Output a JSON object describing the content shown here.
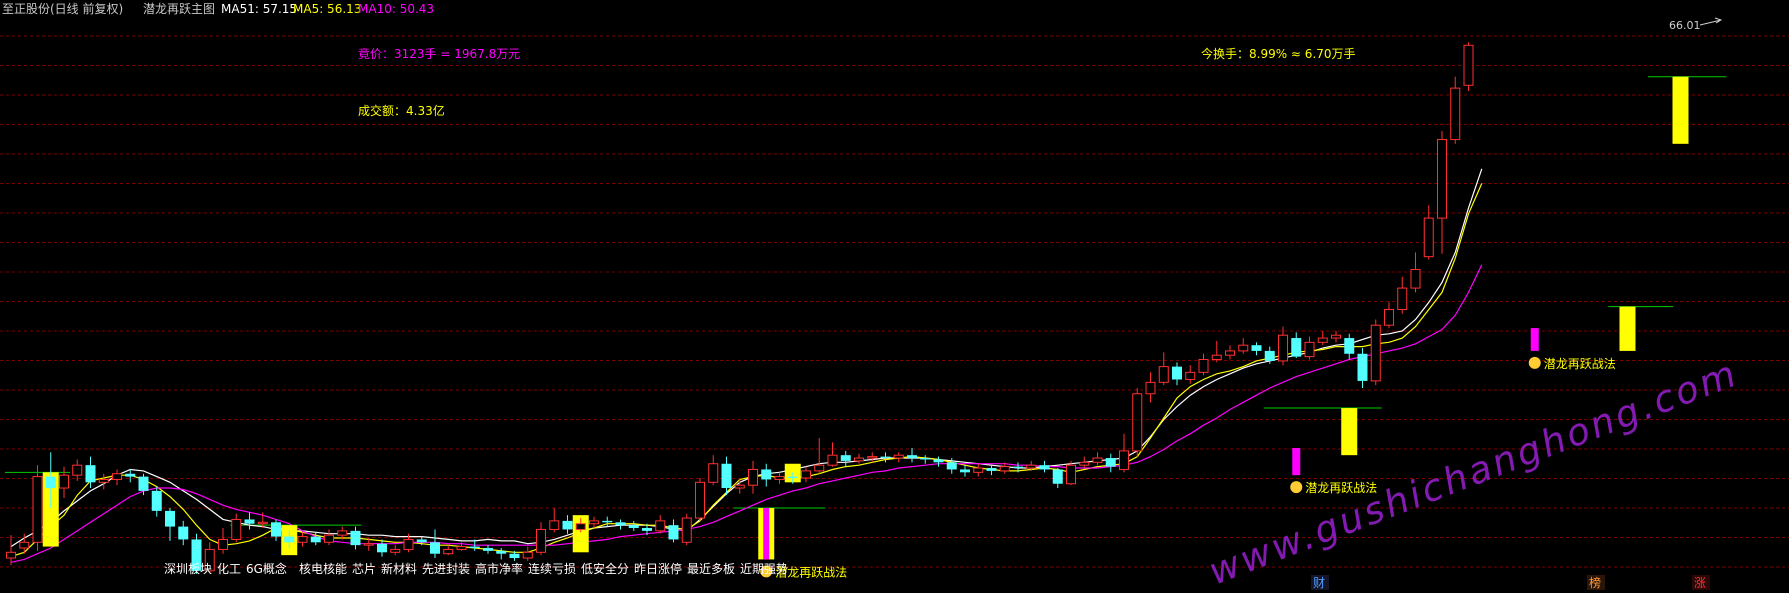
{
  "header": {
    "stock_name": "至正股份(日线 前复权)",
    "indicator_name": "潜龙再跃主图",
    "ma51": {
      "label": "MA51: 57.15",
      "color": "#ffffff"
    },
    "ma5": {
      "label": "MA5: 56.13",
      "color": "#ffff00"
    },
    "ma10": {
      "label": "MA10: 50.43",
      "color": "#ff00ff"
    }
  },
  "info": {
    "auction": "竟价：3123手 = 1967.8万元",
    "turnover_rate": "今换手：8.99% ≈ 6.70万手",
    "amount": "成交额：4.33亿",
    "high_label": "66.01"
  },
  "signal_text": "潜龙再跃战法",
  "concepts": [
    "深圳板块",
    "化工",
    "6G概念",
    "核电核能",
    "芯片",
    "新材料",
    "先进封装",
    "高市净率",
    "连续亏损",
    "低安全分",
    "昨日涨停",
    "最近多板",
    "近期强势"
  ],
  "bottom_markers": [
    {
      "text": "财",
      "color": "#4f9dff"
    },
    {
      "text": "榜",
      "color": "#ff9a3c"
    },
    {
      "text": "涨",
      "color": "#ff3030"
    }
  ],
  "watermark": "www.gushichanghong.com",
  "colors": {
    "up": "#ff3030",
    "down": "#54ffff",
    "signal_yellow": "#ffff00",
    "signal_magenta": "#ff00ff",
    "support": "#00cc00",
    "grid": "#7a0000"
  },
  "chart_data": {
    "type": "candlestick",
    "y_range": [
      28.5,
      67.5
    ],
    "candles": [
      [
        29.9,
        30.3,
        31.5,
        29.4
      ],
      [
        30.6,
        31.0,
        31.6,
        30.2
      ],
      [
        31.0,
        35.6,
        36.4,
        30.4
      ],
      [
        35.6,
        34.8,
        37.3,
        33.4
      ],
      [
        34.8,
        35.7,
        36.3,
        34.1
      ],
      [
        35.7,
        36.4,
        36.8,
        35.3
      ],
      [
        36.4,
        35.2,
        37.0,
        34.8
      ],
      [
        35.2,
        35.4,
        35.8,
        34.7
      ],
      [
        35.4,
        35.8,
        36.1,
        35.0
      ],
      [
        35.8,
        35.6,
        36.1,
        35.2
      ],
      [
        35.6,
        34.6,
        35.8,
        34.3
      ],
      [
        34.6,
        33.2,
        34.9,
        32.8
      ],
      [
        33.2,
        32.1,
        33.4,
        31.1
      ],
      [
        32.1,
        31.2,
        32.5,
        30.8
      ],
      [
        31.2,
        29.0,
        31.6,
        28.8
      ],
      [
        29.0,
        30.5,
        31.0,
        28.9
      ],
      [
        30.5,
        31.2,
        32.0,
        30.2
      ],
      [
        31.2,
        32.6,
        33.0,
        31.0
      ],
      [
        32.6,
        32.3,
        33.1,
        31.9
      ],
      [
        32.3,
        32.4,
        33.1,
        32.0
      ],
      [
        32.4,
        31.4,
        32.6,
        31.1
      ],
      [
        31.4,
        31.0,
        31.8,
        30.6
      ],
      [
        31.0,
        31.4,
        31.7,
        30.7
      ],
      [
        31.4,
        31.0,
        31.7,
        30.8
      ],
      [
        31.0,
        31.5,
        31.9,
        30.8
      ],
      [
        31.5,
        31.8,
        32.1,
        31.2
      ],
      [
        31.8,
        30.8,
        32.1,
        30.5
      ],
      [
        30.8,
        30.9,
        31.3,
        30.4
      ],
      [
        30.9,
        30.3,
        31.2,
        30.0
      ],
      [
        30.3,
        30.5,
        30.8,
        30.1
      ],
      [
        30.5,
        31.2,
        31.6,
        30.3
      ],
      [
        31.2,
        31.0,
        31.4,
        30.8
      ],
      [
        31.0,
        30.2,
        31.9,
        29.9
      ],
      [
        30.2,
        30.5,
        30.8,
        30.1
      ],
      [
        30.5,
        30.7,
        31.0,
        30.4
      ],
      [
        30.7,
        30.6,
        31.2,
        30.4
      ],
      [
        30.6,
        30.4,
        30.8,
        30.2
      ],
      [
        30.4,
        30.2,
        30.6,
        29.8
      ],
      [
        30.2,
        29.9,
        30.4,
        29.7
      ],
      [
        29.9,
        30.3,
        30.7,
        29.7
      ],
      [
        30.3,
        31.9,
        32.4,
        30.1
      ],
      [
        31.9,
        32.5,
        33.4,
        31.7
      ],
      [
        32.5,
        31.9,
        32.9,
        31.6
      ],
      [
        31.9,
        32.3,
        32.7,
        31.7
      ],
      [
        32.3,
        32.5,
        32.8,
        32.0
      ],
      [
        32.5,
        32.4,
        32.8,
        32.1
      ],
      [
        32.4,
        32.2,
        32.6,
        31.9
      ],
      [
        32.2,
        32.0,
        32.5,
        31.8
      ],
      [
        32.0,
        31.8,
        32.3,
        31.5
      ],
      [
        31.8,
        32.5,
        32.9,
        31.6
      ],
      [
        32.2,
        31.2,
        32.6,
        31.0
      ],
      [
        31.0,
        32.7,
        33.0,
        30.8
      ],
      [
        32.7,
        35.2,
        35.5,
        32.5
      ],
      [
        35.2,
        36.5,
        37.1,
        35.0
      ],
      [
        36.5,
        34.8,
        37.0,
        34.3
      ],
      [
        34.8,
        35.0,
        35.4,
        34.4
      ],
      [
        35.0,
        36.1,
        36.7,
        34.4
      ],
      [
        36.1,
        35.4,
        36.5,
        34.9
      ],
      [
        35.4,
        35.6,
        35.9,
        35.1
      ],
      [
        35.6,
        35.5,
        35.9,
        35.1
      ],
      [
        35.5,
        36.0,
        36.3,
        35.2
      ],
      [
        36.0,
        36.4,
        38.3,
        35.8
      ],
      [
        36.4,
        37.1,
        38.0,
        36.3
      ],
      [
        37.1,
        36.7,
        37.4,
        36.3
      ],
      [
        36.7,
        36.9,
        37.2,
        36.5
      ],
      [
        36.9,
        37.0,
        37.3,
        36.6
      ],
      [
        37.0,
        36.9,
        37.3,
        36.6
      ],
      [
        36.9,
        37.1,
        37.3,
        36.6
      ],
      [
        37.1,
        36.9,
        37.6,
        36.6
      ],
      [
        36.9,
        36.8,
        37.1,
        36.5
      ],
      [
        36.8,
        36.6,
        37.0,
        36.3
      ],
      [
        36.6,
        36.1,
        36.9,
        35.8
      ],
      [
        36.1,
        35.9,
        36.4,
        35.6
      ],
      [
        35.9,
        36.2,
        36.5,
        35.6
      ],
      [
        36.2,
        36.0,
        36.4,
        35.7
      ],
      [
        36.0,
        36.3,
        36.6,
        35.8
      ],
      [
        36.3,
        36.2,
        36.6,
        35.9
      ],
      [
        36.2,
        36.4,
        36.7,
        36.0
      ],
      [
        36.4,
        36.1,
        36.7,
        35.9
      ],
      [
        36.1,
        35.1,
        36.2,
        34.8
      ],
      [
        35.1,
        36.4,
        36.7,
        35.0
      ],
      [
        36.4,
        36.6,
        37.0,
        36.2
      ],
      [
        36.6,
        36.9,
        37.3,
        36.4
      ],
      [
        36.9,
        36.3,
        37.2,
        35.9
      ],
      [
        36.1,
        37.4,
        38.6,
        35.9
      ],
      [
        37.4,
        41.4,
        41.8,
        37.0
      ],
      [
        41.4,
        42.2,
        42.9,
        40.8
      ],
      [
        42.2,
        43.3,
        44.3,
        42.0
      ],
      [
        43.3,
        42.4,
        43.6,
        42.0
      ],
      [
        42.4,
        42.9,
        43.4,
        42.1
      ],
      [
        42.9,
        43.8,
        44.2,
        42.7
      ],
      [
        43.8,
        44.1,
        45.1,
        43.6
      ],
      [
        44.1,
        44.4,
        44.8,
        43.8
      ],
      [
        44.4,
        44.8,
        45.3,
        44.2
      ],
      [
        44.8,
        44.4,
        45.0,
        44.1
      ],
      [
        44.4,
        43.7,
        44.7,
        43.5
      ],
      [
        43.7,
        45.5,
        46.1,
        43.4
      ],
      [
        45.3,
        44.0,
        45.7,
        43.9
      ],
      [
        44.0,
        45.0,
        45.4,
        43.8
      ],
      [
        45.0,
        45.3,
        45.8,
        44.8
      ],
      [
        45.3,
        45.5,
        45.8,
        45.0
      ],
      [
        45.3,
        44.2,
        45.6,
        43.8
      ],
      [
        44.2,
        42.3,
        44.6,
        41.8
      ],
      [
        42.3,
        46.2,
        46.6,
        42.0
      ],
      [
        46.2,
        47.3,
        47.8,
        46.0
      ],
      [
        47.3,
        48.8,
        49.6,
        47.0
      ],
      [
        48.8,
        50.1,
        51.3,
        48.5
      ],
      [
        51.0,
        53.7,
        54.6,
        50.8
      ],
      [
        53.7,
        59.2,
        59.8,
        51.2
      ],
      [
        59.2,
        62.8,
        63.6,
        58.9
      ],
      [
        63.0,
        65.8,
        66.0,
        62.6
      ]
    ],
    "ma51": [
      30.7,
      31.3,
      31.8,
      32.4,
      33.2,
      33.9,
      34.6,
      35.1,
      35.7,
      36.1,
      36.0,
      35.6,
      35.2,
      34.6,
      34.0,
      33.3,
      32.6,
      32.4,
      32.2,
      32.1,
      31.9,
      31.8,
      31.8,
      31.7,
      31.6,
      31.6,
      31.6,
      31.5,
      31.5,
      31.4,
      31.4,
      31.4,
      31.3,
      31.2,
      31.1,
      31.1,
      31.2,
      31.1,
      31.1,
      30.9,
      31.0,
      31.2,
      31.5,
      31.8,
      32.0,
      32.1,
      32.2,
      32.2,
      32.2,
      32.1,
      31.9,
      31.8,
      32.6,
      33.5,
      34.4,
      35.2,
      35.6,
      35.8,
      35.9,
      36.1,
      36.3,
      36.5,
      36.6,
      36.6,
      36.7,
      36.8,
      36.9,
      36.9,
      36.9,
      36.9,
      36.8,
      36.7,
      36.6,
      36.5,
      36.4,
      36.3,
      36.2,
      36.2,
      36.3,
      36.4,
      36.5,
      36.6,
      36.7,
      36.8,
      36.9,
      37.4,
      38.4,
      39.6,
      40.5,
      41.3,
      41.9,
      42.4,
      42.8,
      43.2,
      43.5,
      43.7,
      43.9,
      44.1,
      44.3,
      44.6,
      44.8,
      44.9,
      45.2,
      45.5,
      45.6,
      45.8,
      46.6,
      47.8,
      49.2,
      51.3,
      54.4,
      57.15
    ],
    "ma5": [
      30.0,
      30.3,
      31.2,
      32.1,
      32.9,
      34.3,
      35.3,
      35.5,
      35.7,
      35.7,
      35.4,
      34.9,
      34.2,
      33.3,
      32.2,
      31.2,
      30.8,
      30.9,
      31.1,
      31.5,
      32.0,
      31.9,
      31.7,
      31.5,
      31.3,
      31.3,
      31.3,
      31.2,
      31.1,
      31.0,
      31.0,
      30.9,
      30.8,
      30.8,
      30.7,
      30.6,
      30.5,
      30.4,
      30.3,
      30.3,
      30.6,
      31.0,
      31.3,
      31.7,
      32.0,
      32.3,
      32.3,
      32.3,
      32.2,
      32.2,
      32.0,
      31.9,
      32.5,
      33.6,
      34.5,
      35.4,
      35.6,
      35.7,
      35.5,
      35.5,
      35.6,
      35.8,
      36.1,
      36.3,
      36.4,
      36.6,
      36.8,
      36.9,
      37.0,
      36.9,
      36.8,
      36.6,
      36.4,
      36.2,
      36.1,
      36.0,
      36.0,
      36.1,
      36.2,
      36.1,
      35.9,
      36.1,
      36.3,
      36.4,
      36.5,
      37.0,
      38.3,
      39.7,
      41.1,
      41.9,
      42.4,
      42.8,
      43.0,
      43.3,
      43.7,
      43.9,
      44.1,
      44.3,
      44.4,
      44.5,
      44.7,
      44.7,
      44.7,
      44.9,
      45.0,
      45.3,
      46.1,
      47.3,
      48.5,
      50.9,
      54.0,
      56.13
    ],
    "ma10": [
      29.6,
      29.8,
      30.2,
      30.6,
      31.2,
      31.8,
      32.4,
      33.0,
      33.6,
      34.2,
      34.6,
      34.8,
      34.8,
      34.7,
      34.4,
      34.0,
      33.6,
      33.3,
      33.1,
      32.9,
      32.6,
      32.3,
      31.8,
      31.4,
      31.1,
      31.0,
      30.9,
      30.9,
      30.9,
      30.9,
      31.0,
      31.0,
      31.0,
      30.9,
      30.9,
      30.8,
      30.8,
      30.8,
      30.8,
      30.8,
      30.8,
      30.8,
      30.9,
      31.0,
      31.1,
      31.2,
      31.4,
      31.5,
      31.6,
      31.7,
      31.8,
      31.9,
      32.1,
      32.4,
      32.8,
      33.2,
      33.6,
      34.0,
      34.3,
      34.6,
      34.8,
      35.1,
      35.3,
      35.5,
      35.7,
      35.9,
      36.0,
      36.2,
      36.3,
      36.4,
      36.5,
      36.5,
      36.5,
      36.5,
      36.5,
      36.5,
      36.4,
      36.4,
      36.3,
      36.3,
      36.2,
      36.2,
      36.2,
      36.3,
      36.4,
      36.6,
      37.0,
      37.5,
      38.1,
      38.6,
      39.2,
      39.7,
      40.3,
      40.8,
      41.3,
      41.8,
      42.2,
      42.6,
      42.9,
      43.2,
      43.5,
      43.8,
      44.0,
      44.2,
      44.4,
      44.6,
      44.9,
      45.4,
      45.9,
      46.9,
      48.5,
      50.43
    ],
    "signal_bars": [
      {
        "index": 3,
        "kind": "yellow",
        "low": 30.7,
        "high": 35.9
      },
      {
        "index": 21,
        "kind": "yellow",
        "low": 30.1,
        "high": 32.2
      },
      {
        "index": 43,
        "kind": "yellow",
        "low": 30.3,
        "high": 32.9
      },
      {
        "index": 57,
        "kind": "yellow_magenta",
        "low": 29.8,
        "high": 33.4
      },
      {
        "index": 59,
        "kind": "yellow",
        "low": 35.2,
        "high": 36.5
      },
      {
        "index": 97,
        "kind": "magenta",
        "low": 35.7,
        "high": 37.6
      },
      {
        "index": 101,
        "kind": "yellow",
        "low": 37.1,
        "high": 40.4
      },
      {
        "index": 115,
        "kind": "magenta",
        "low": 44.4,
        "high": 46.0
      },
      {
        "index": 122,
        "kind": "yellow",
        "low": 44.4,
        "high": 47.5
      },
      {
        "index": 126,
        "kind": "yellow",
        "low": 58.9,
        "high": 63.6
      }
    ],
    "support_lines": [
      {
        "from": 0,
        "to": 4,
        "value": 35.9
      },
      {
        "from": 17,
        "to": 26,
        "value": 32.2
      },
      {
        "from": 55,
        "to": 61,
        "value": 33.4
      },
      {
        "from": 95,
        "to": 103,
        "value": 40.4
      },
      {
        "from": 121,
        "to": 125,
        "value": 47.5
      },
      {
        "from": 124,
        "to": 129,
        "value": 63.6
      }
    ],
    "signal_labels": [
      57,
      97,
      115
    ]
  }
}
